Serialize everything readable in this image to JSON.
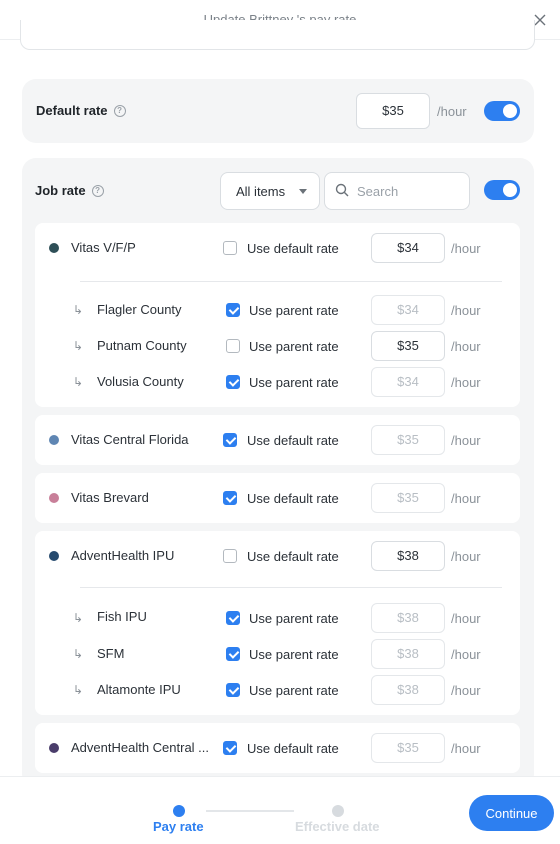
{
  "dialog": {
    "title": "Update Brittney 's pay rate"
  },
  "default_rate": {
    "title": "Default rate",
    "value": "$35",
    "unit": "/hour",
    "toggle_on": true
  },
  "job_rate": {
    "title": "Job rate",
    "filter_value": "All items",
    "search_placeholder": "Search",
    "toggle_on": true,
    "unit": "/hour",
    "jobs": [
      {
        "name": "Vitas V/F/P",
        "color": "#2e4f57",
        "check_label": "Use default rate",
        "checked": false,
        "rate": "$34",
        "children": [
          {
            "name": "Flagler County",
            "check_label": "Use parent rate",
            "checked": true,
            "rate": "$34"
          },
          {
            "name": "Putnam County",
            "check_label": "Use parent rate",
            "checked": false,
            "rate": "$35"
          },
          {
            "name": "Volusia County",
            "check_label": "Use parent rate",
            "checked": true,
            "rate": "$34"
          }
        ]
      },
      {
        "name": "Vitas Central Florida",
        "color": "#5f86b3",
        "check_label": "Use default rate",
        "checked": true,
        "rate": "$35",
        "children": []
      },
      {
        "name": "Vitas Brevard",
        "color": "#c87f99",
        "check_label": "Use default rate",
        "checked": true,
        "rate": "$35",
        "children": []
      },
      {
        "name": "AdventHealth IPU",
        "color": "#264a6e",
        "check_label": "Use default rate",
        "checked": false,
        "rate": "$38",
        "children": [
          {
            "name": "Fish IPU",
            "check_label": "Use parent rate",
            "checked": true,
            "rate": "$38"
          },
          {
            "name": "SFM",
            "check_label": "Use parent rate",
            "checked": true,
            "rate": "$38"
          },
          {
            "name": "Altamonte IPU",
            "check_label": "Use parent rate",
            "checked": true,
            "rate": "$38"
          }
        ]
      },
      {
        "name": "AdventHealth Central ...",
        "color": "#4a3d6b",
        "check_label": "Use default rate",
        "checked": true,
        "rate": "$35",
        "children": []
      }
    ]
  },
  "stepper": {
    "steps": [
      {
        "label": "Pay rate",
        "active": true
      },
      {
        "label": "Effective date",
        "active": false
      }
    ]
  },
  "continue_label": "Continue",
  "colors": {
    "accent": "#2d7ff0",
    "inactive_step": "#d7dbdf"
  },
  "icons": {
    "close": "close-icon",
    "help": "help-icon",
    "search": "search-icon",
    "caret": "chevron-down-icon",
    "child": "child-arrow-icon"
  }
}
